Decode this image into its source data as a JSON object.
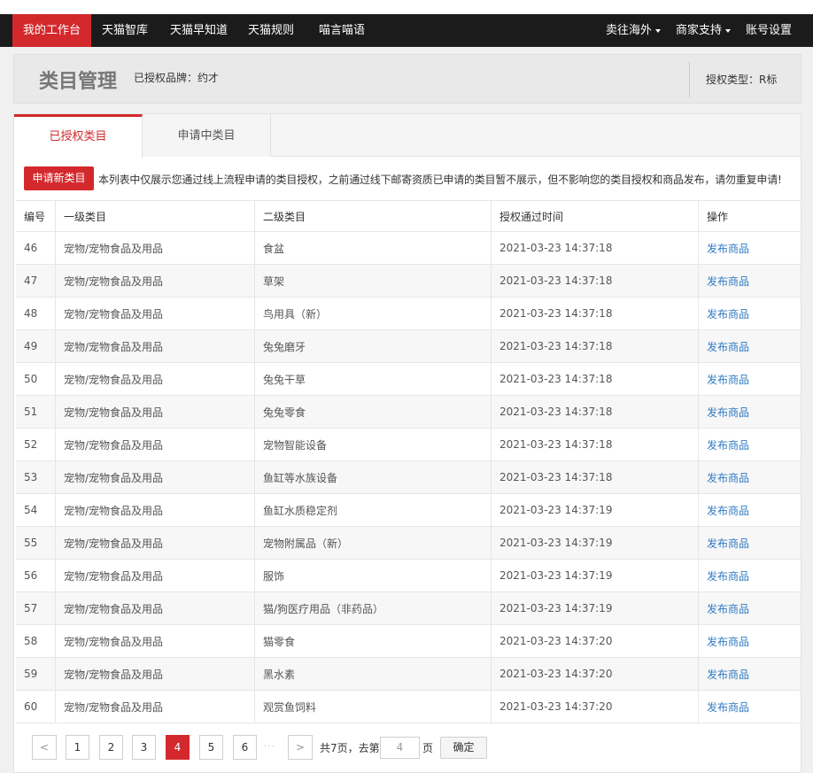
{
  "nav": {
    "items": [
      {
        "label": "我的工作台",
        "active": true
      },
      {
        "label": "天猫智库"
      },
      {
        "label": "天猫早知道"
      },
      {
        "label": "天猫规则"
      },
      {
        "label": "喵言喵语"
      }
    ],
    "right": [
      {
        "label": "卖往海外",
        "dropdown": true
      },
      {
        "label": "商家支持",
        "dropdown": true
      },
      {
        "label": "账号设置"
      }
    ]
  },
  "header": {
    "title": "类目管理",
    "brand": "已授权品牌：约才",
    "auth_type": "授权类型：R标"
  },
  "tabs": [
    "已授权类目",
    "申请中类目"
  ],
  "notice": {
    "button": "申请新类目",
    "text": "本列表中仅展示您通过线上流程申请的类目授权，之前通过线下邮寄资质已申请的类目暂不展示，但不影响您的类目授权和商品发布，请勿重复申请!"
  },
  "table": {
    "columns": [
      "编号",
      "一级类目",
      "二级类目",
      "授权通过时间",
      "操作"
    ],
    "rows": [
      [
        "46",
        "宠物/宠物食品及用品",
        "食盆",
        "2021-03-23 14:37:18",
        "发布商品"
      ],
      [
        "47",
        "宠物/宠物食品及用品",
        "草架",
        "2021-03-23 14:37:18",
        "发布商品"
      ],
      [
        "48",
        "宠物/宠物食品及用品",
        "鸟用具（新）",
        "2021-03-23 14:37:18",
        "发布商品"
      ],
      [
        "49",
        "宠物/宠物食品及用品",
        "兔兔磨牙",
        "2021-03-23 14:37:18",
        "发布商品"
      ],
      [
        "50",
        "宠物/宠物食品及用品",
        "兔兔干草",
        "2021-03-23 14:37:18",
        "发布商品"
      ],
      [
        "51",
        "宠物/宠物食品及用品",
        "兔兔零食",
        "2021-03-23 14:37:18",
        "发布商品"
      ],
      [
        "52",
        "宠物/宠物食品及用品",
        "宠物智能设备",
        "2021-03-23 14:37:18",
        "发布商品"
      ],
      [
        "53",
        "宠物/宠物食品及用品",
        "鱼缸等水族设备",
        "2021-03-23 14:37:18",
        "发布商品"
      ],
      [
        "54",
        "宠物/宠物食品及用品",
        "鱼缸水质稳定剂",
        "2021-03-23 14:37:19",
        "发布商品"
      ],
      [
        "55",
        "宠物/宠物食品及用品",
        "宠物附属品（新）",
        "2021-03-23 14:37:19",
        "发布商品"
      ],
      [
        "56",
        "宠物/宠物食品及用品",
        "服饰",
        "2021-03-23 14:37:19",
        "发布商品"
      ],
      [
        "57",
        "宠物/宠物食品及用品",
        "猫/狗医疗用品（非药品）",
        "2021-03-23 14:37:19",
        "发布商品"
      ],
      [
        "58",
        "宠物/宠物食品及用品",
        "猫零食",
        "2021-03-23 14:37:20",
        "发布商品"
      ],
      [
        "59",
        "宠物/宠物食品及用品",
        "黑水素",
        "2021-03-23 14:37:20",
        "发布商品"
      ],
      [
        "60",
        "宠物/宠物食品及用品",
        "观赏鱼饲料",
        "2021-03-23 14:37:20",
        "发布商品"
      ]
    ]
  },
  "pagination": {
    "prev": "<",
    "next": ">",
    "pages": [
      "1",
      "2",
      "3",
      "4",
      "5",
      "6"
    ],
    "current": "4",
    "ellipsis": "···",
    "total_text": "共7页，去第",
    "goto_value": "4",
    "page_suffix": "页",
    "confirm": "确定"
  },
  "colors": {
    "accent": "#d3292d",
    "link": "#2f7bc4",
    "nav_bg": "#1b1b1b"
  }
}
